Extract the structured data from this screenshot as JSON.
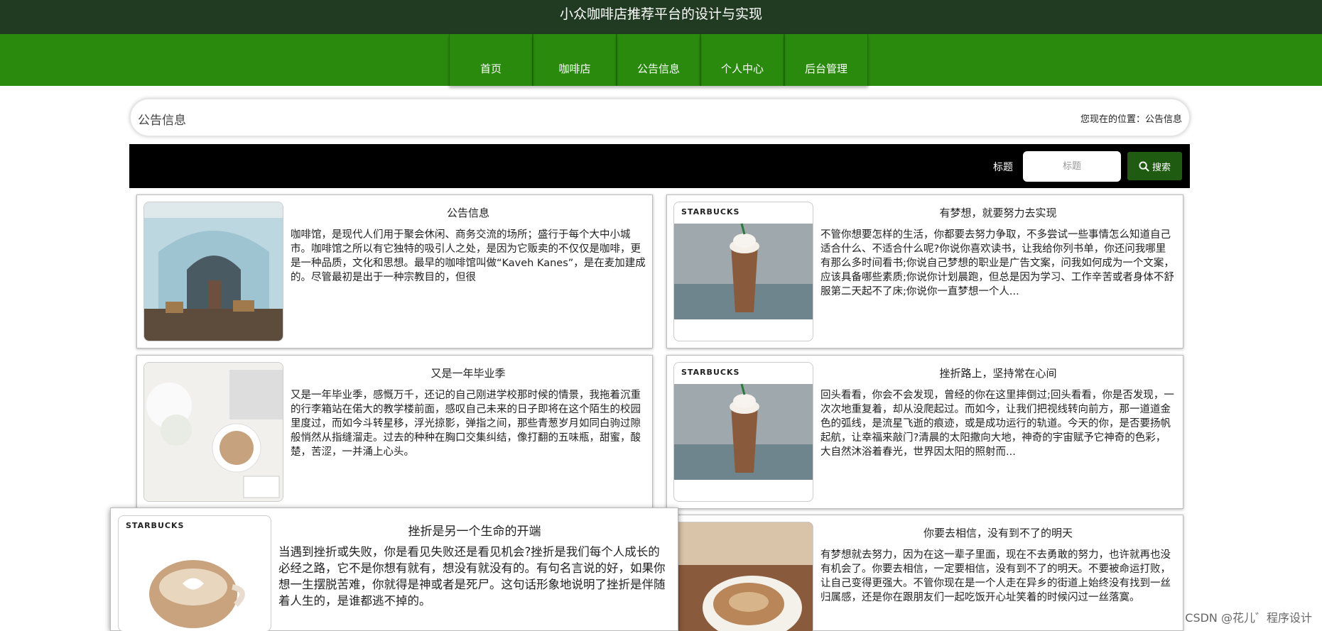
{
  "header": {
    "site_title": "小众咖啡店推荐平台的设计与实现"
  },
  "nav": {
    "items": [
      {
        "label": "首页"
      },
      {
        "label": "咖啡店"
      },
      {
        "label": "公告信息"
      },
      {
        "label": "个人中心"
      },
      {
        "label": "后台管理"
      }
    ]
  },
  "breadcrumb": {
    "page_title": "公告信息",
    "location_prefix": "您现在的位置：",
    "location_current": "公告信息"
  },
  "search": {
    "label": "标题",
    "placeholder": "标题",
    "button_label": "搜索",
    "icon": "search-icon"
  },
  "brand_text": "STARBUCKS",
  "colors": {
    "header_bg": "#213a22",
    "nav_bg": "#2a8a0e",
    "search_bar_bg": "#000000",
    "search_button_bg": "#1f5c12"
  },
  "cards": [
    {
      "title": "公告信息",
      "body": "咖啡馆，是现代人们用于聚会休闲、商务交流的场所；盛行于每个大中小城市。咖啡馆之所以有它独特的吸引人之处，是因为它贩卖的不仅仅是咖啡，更是一种品质，文化和思想。最早的咖啡馆叫做“Kaveh Kanes”，是在麦加建成的。尽管最初是出于一种宗教目的，但很"
    },
    {
      "title": "有梦想，就要努力去实现",
      "body": "不管你想要怎样的生活，你都要去努力争取，不多尝试一些事情怎么知道自己适合什么、不适合什么呢?你说你喜欢读书，让我给你列书单，你还问我哪里有那么多时间看书;你说自己梦想的职业是广告文案，问我如何成为一个文案，应该具备哪些素质;你说你计划晨跑，但总是因为学习、工作辛苦或者身体不舒服第二天起不了床;你说你一直梦想一个人..."
    },
    {
      "title": "又是一年毕业季",
      "body": "又是一年毕业季，感慨万千，还记的自己刚进学校那时候的情景，我拖着沉重的行李箱站在偌大的教学楼前面，感叹自己未来的日子即将在这个陌生的校园里度过，而如今斗转星移，浮光掠影，弹指之间，那些青葱岁月如同白驹过隙般悄然从指缝溜走。过去的种种在胸口交集纠结，像打翻的五味瓶，甜蜜，酸楚，苦涩，一并涌上心头。"
    },
    {
      "title": "挫折路上，坚持常在心间",
      "body": "回头看看，你会不会发现，曾经的你在这里摔倒过;回头看看，你是否发现，一次次地重复着，却从没爬起过。而如今，让我们把视线转向前方，那一道道金色的弧线，是流星飞逝的痕迹，或是成功运行的轨道。今天的你，是否要扬帆起航，让幸福来敲门?清晨的太阳撒向大地，神奇的宇宙赋予它神奇的色彩，大自然沐浴着春光，世界因太阳的照射而..."
    },
    {
      "title": "挫折是另一个生命的开端",
      "body": "当遇到挫折或失败，你是看见失败还是看见机会?挫折是我们每个人成长的必经之路，它不是你想有就有，想没有就没有的。有句名言说的好，如果你想一生摆脱苦难，你就得是神或者是死尸。这句话形象地说明了挫折是伴随着人生的，是谁都逃不掉的。"
    },
    {
      "title": "你要去相信，没有到不了的明天",
      "body": "有梦想就去努力，因为在这一辈子里面，现在不去勇敢的努力，也许就再也没有机会了。你要去相信，一定要相信，没有到不了的明天。不要被命运打败，让自己变得更强大。不管你现在是一个人走在异乡的街道上始终没有找到一丝归属感，还是你在跟朋友们一起吃饭开心址笑着的时候闪过一丝落寞。"
    }
  ],
  "watermark": "CSDN @花儿゛程序设计"
}
